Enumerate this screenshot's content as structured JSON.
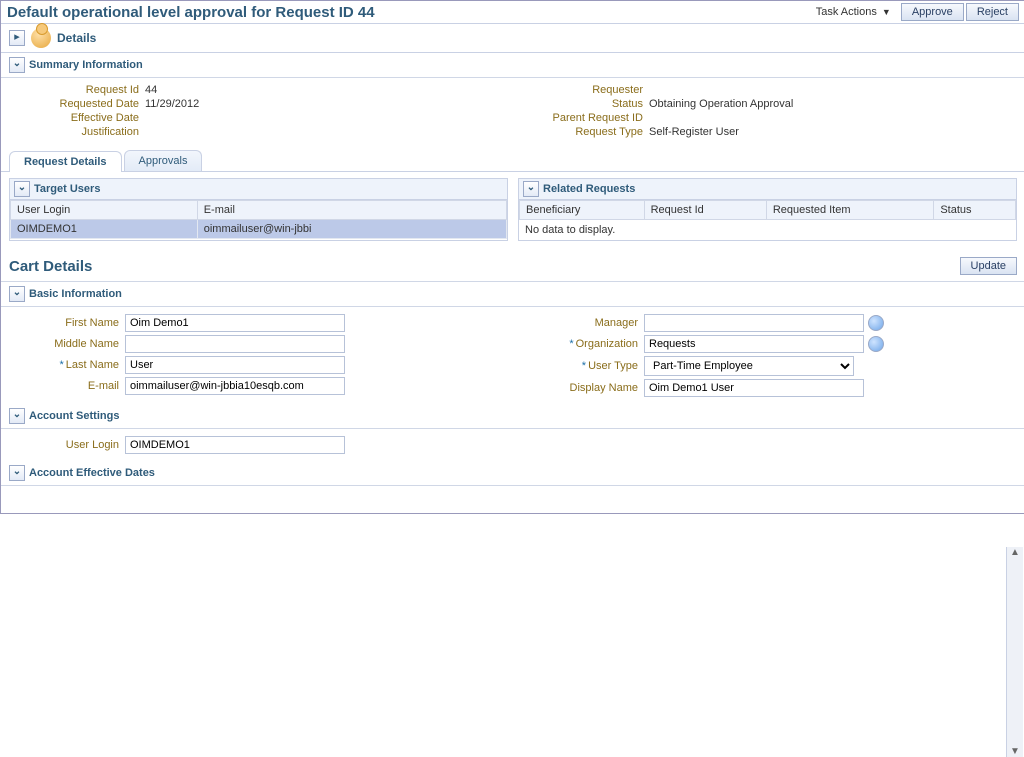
{
  "header": {
    "title": "Default operational level approval for Request ID 44",
    "task_actions_label": "Task Actions",
    "approve_label": "Approve",
    "reject_label": "Reject"
  },
  "details": {
    "title": "Details"
  },
  "summary": {
    "title": "Summary Information",
    "left": {
      "request_id_label": "Request Id",
      "request_id": "44",
      "requested_date_label": "Requested Date",
      "requested_date": "11/29/2012",
      "effective_date_label": "Effective Date",
      "effective_date": "",
      "justification_label": "Justification",
      "justification": ""
    },
    "right": {
      "requester_label": "Requester",
      "requester": "",
      "status_label": "Status",
      "status": "Obtaining Operation Approval",
      "parent_req_label": "Parent Request ID",
      "parent_req": "",
      "request_type_label": "Request Type",
      "request_type": "Self-Register User"
    }
  },
  "tabs": {
    "request_details": "Request Details",
    "approvals": "Approvals"
  },
  "target_users": {
    "title": "Target Users",
    "cols": {
      "login": "User Login",
      "email": "E-mail"
    },
    "row": {
      "login": "OIMDEMO1",
      "email": "oimmailuser@win-jbbi"
    }
  },
  "related_requests": {
    "title": "Related Requests",
    "cols": {
      "beneficiary": "Beneficiary",
      "request_id": "Request Id",
      "item": "Requested Item",
      "status": "Status"
    },
    "empty": "No data to display."
  },
  "cart": {
    "title": "Cart Details",
    "update_label": "Update"
  },
  "basic_info": {
    "title": "Basic Information",
    "first_name_label": "First Name",
    "first_name": "Oim Demo1",
    "middle_name_label": "Middle Name",
    "middle_name": "",
    "last_name_label": "Last Name",
    "last_name": "User",
    "email_label": "E-mail",
    "email": "oimmailuser@win-jbbia10esqb.com",
    "manager_label": "Manager",
    "manager": "",
    "organization_label": "Organization",
    "organization": "Requests",
    "user_type_label": "User Type",
    "user_type": "Part-Time Employee",
    "display_name_label": "Display Name",
    "display_name": "Oim Demo1 User"
  },
  "account_settings": {
    "title": "Account Settings",
    "user_login_label": "User Login",
    "user_login": "OIMDEMO1"
  },
  "account_dates": {
    "title": "Account Effective Dates"
  }
}
